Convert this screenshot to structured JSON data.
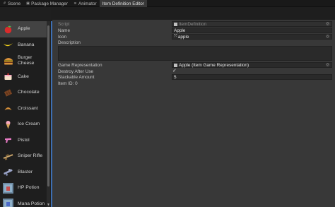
{
  "tabs": [
    {
      "label": "Scene",
      "icon": "hash-icon"
    },
    {
      "label": "Package Manager",
      "icon": "package-icon"
    },
    {
      "label": "Animator",
      "icon": "animator-icon"
    },
    {
      "label": "Item Definition Editor",
      "icon": ""
    }
  ],
  "items": [
    {
      "label": "Apple",
      "icon": "apple-icon",
      "selected": true
    },
    {
      "label": "Banana",
      "icon": "banana-icon"
    },
    {
      "label": "Burger Cheese",
      "icon": "burger-icon"
    },
    {
      "label": "Cake",
      "icon": "cake-icon"
    },
    {
      "label": "Chocolate",
      "icon": "chocolate-icon"
    },
    {
      "label": "Croissant",
      "icon": "croissant-icon"
    },
    {
      "label": "Ice Cream",
      "icon": "ice-cream-icon"
    },
    {
      "label": "Pistol",
      "icon": "pistol-icon"
    },
    {
      "label": "Sniper Rifle",
      "icon": "sniper-rifle-icon"
    },
    {
      "label": "Blaster",
      "icon": "blaster-icon"
    },
    {
      "label": "HP Potion",
      "icon": "hp-potion-icon"
    },
    {
      "label": "Mana Potion",
      "icon": "mana-potion-icon"
    }
  ],
  "inspector": {
    "script_label": "Script",
    "script_value": "ItemDefinition",
    "name_label": "Name",
    "name_value": "Apple",
    "icon_label": "Icon",
    "icon_value": "apple",
    "description_label": "Description",
    "description_value": "",
    "game_rep_label": "Game Representation",
    "game_rep_value": "Apple (Item Game Representation)",
    "destroy_label": "Destroy After Use",
    "destroy_value": "✓",
    "stackable_label": "Stackable Amount",
    "stackable_value": "5",
    "item_id_label": "Item ID: 0"
  },
  "colors": {
    "accent": "#3d6fb3",
    "panel": "#383838",
    "sidebar": "#232323"
  }
}
